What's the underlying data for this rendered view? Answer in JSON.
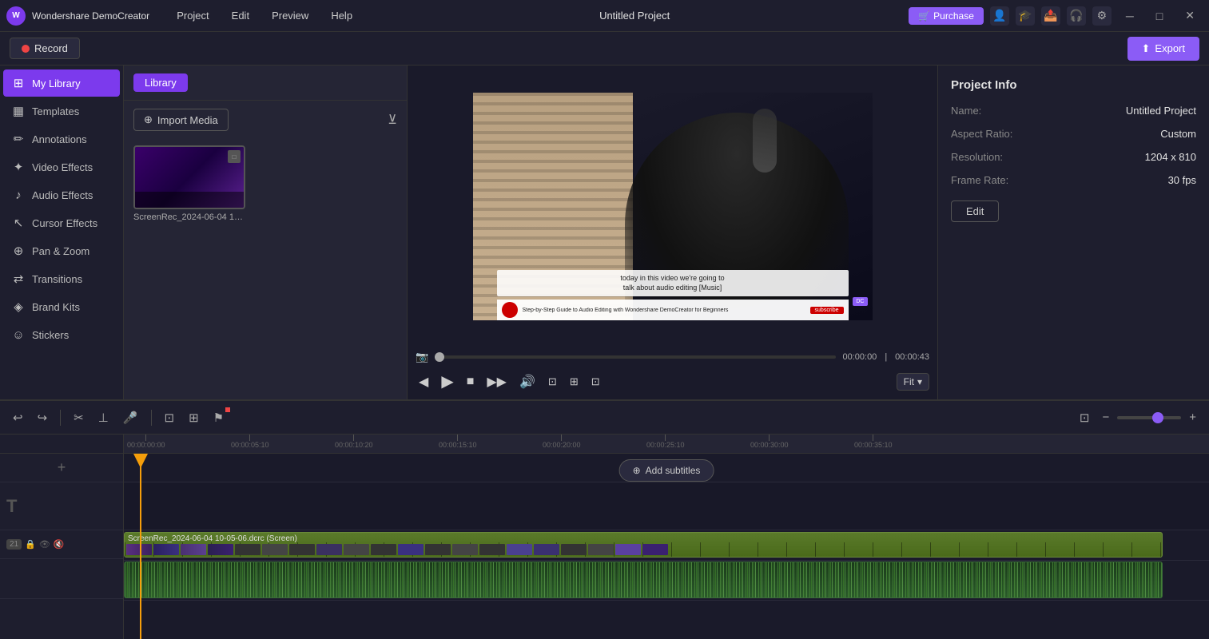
{
  "app": {
    "name": "Wondershare DemoCreator",
    "logo": "W",
    "title": "Untitled Project"
  },
  "menu": {
    "items": [
      "Project",
      "Edit",
      "Preview",
      "Help"
    ]
  },
  "titlebar": {
    "purchase_label": "Purchase",
    "minimize": "─",
    "maximize": "□",
    "close": "✕"
  },
  "toolbar": {
    "record_label": "Record",
    "export_label": "Export"
  },
  "sidebar": {
    "items": [
      {
        "label": "My Library",
        "icon": "⊞",
        "active": true
      },
      {
        "label": "Templates",
        "icon": "▦"
      },
      {
        "label": "Annotations",
        "icon": "✏"
      },
      {
        "label": "Video Effects",
        "icon": "✦"
      },
      {
        "label": "Audio Effects",
        "icon": "♪"
      },
      {
        "label": "Cursor Effects",
        "icon": "↖"
      },
      {
        "label": "Pan & Zoom",
        "icon": "⊕"
      },
      {
        "label": "Transitions",
        "icon": "⇄"
      },
      {
        "label": "Brand Kits",
        "icon": "◈"
      },
      {
        "label": "Stickers",
        "icon": "☺"
      }
    ]
  },
  "library": {
    "title": "Library",
    "import_label": "Import Media",
    "media_items": [
      {
        "name": "ScreenRec_2024-06-04 10-0...",
        "has_thumb": true
      }
    ]
  },
  "preview": {
    "caption_line1": "today in this video we're going to",
    "caption_line2": "talk about audio editing [Music]",
    "channel_info": "Step-by-Step Guide to Audio Editing with Wondershare DemoCreator for Beginners",
    "current_time": "00:00:00",
    "total_time": "00:00:43",
    "fit_label": "Fit"
  },
  "project_info": {
    "title": "Project Info",
    "name_label": "Name:",
    "name_value": "Untitled Project",
    "aspect_ratio_label": "Aspect Ratio:",
    "aspect_ratio_value": "Custom",
    "resolution_label": "Resolution:",
    "resolution_value": "1204 x 810",
    "frame_rate_label": "Frame Rate:",
    "frame_rate_value": "30 fps",
    "edit_label": "Edit"
  },
  "timeline": {
    "tracks": [
      {
        "type": "video",
        "label": "ScreenRec_2024-06-04 10-05-06.dcrc (Screen)",
        "badge": ""
      },
      {
        "type": "audio",
        "label": "audio",
        "badge": ""
      }
    ],
    "ruler_marks": [
      "00:00:00:00",
      "00:00:05:10",
      "00:00:10:20",
      "00:00:15:10",
      "00:00:20:00",
      "00:00:25:10",
      "00:00:30:00",
      "00:00:35:10"
    ],
    "add_subtitles_label": "Add subtitles",
    "track_count_badge": "21"
  }
}
